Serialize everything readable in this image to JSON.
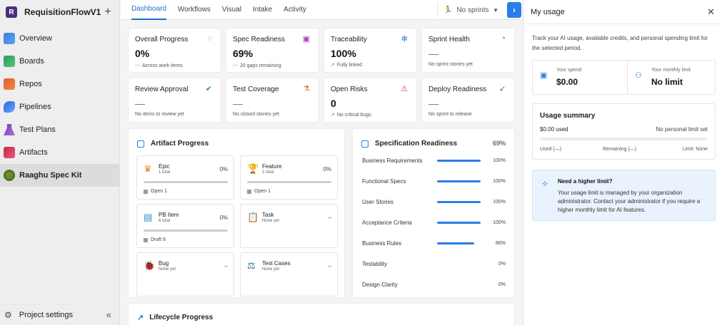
{
  "sidebar": {
    "project_initial": "R",
    "project_name": "RequisitionFlowV1",
    "add_label": "+",
    "items": [
      {
        "label": "Overview",
        "icon": "overview-icon"
      },
      {
        "label": "Boards",
        "icon": "boards-icon"
      },
      {
        "label": "Repos",
        "icon": "repos-icon"
      },
      {
        "label": "Pipelines",
        "icon": "pipelines-icon"
      },
      {
        "label": "Test Plans",
        "icon": "test-plans-icon"
      },
      {
        "label": "Artifacts",
        "icon": "artifacts-icon"
      },
      {
        "label": "Raaghu Spec Kit",
        "icon": "spec-kit-icon",
        "active": true
      }
    ],
    "settings_label": "Project settings",
    "collapse_label": "«"
  },
  "topbar": {
    "tabs": [
      "Dashboard",
      "Workflows",
      "Visual",
      "Intake",
      "Activity"
    ],
    "active_tab": "Dashboard",
    "sprint_label": "No sprints",
    "expand_label": "›"
  },
  "kpis": [
    {
      "title": "Overall Progress",
      "value": "0%",
      "sub": "Across work items",
      "icon": "progress-ring-icon"
    },
    {
      "title": "Spec Readiness",
      "value": "69%",
      "sub": "20 gaps remaining",
      "icon": "spec-icon"
    },
    {
      "title": "Traceability",
      "value": "100%",
      "sub": "Fully linked",
      "icon": "network-icon"
    },
    {
      "title": "Sprint Health",
      "value": "—",
      "sub": "No sprint stories yet",
      "icon": "gauge-icon"
    },
    {
      "title": "Review Approval",
      "value": "—",
      "sub": "No items to review yet",
      "icon": "check-circle-icon"
    },
    {
      "title": "Test Coverage",
      "value": "—",
      "sub": "No closed stories yet",
      "icon": "flask-icon"
    },
    {
      "title": "Open Risks",
      "value": "0",
      "sub": "No critical bugs",
      "icon": "warning-icon"
    },
    {
      "title": "Deploy Readiness",
      "value": "—",
      "sub": "No sprint to release",
      "icon": "rocket-icon"
    }
  ],
  "artifact_progress": {
    "title": "Artifact Progress",
    "items": [
      {
        "name": "Epic",
        "count": "1 total",
        "pct": "0%",
        "status": "Open 1",
        "icon": "crown-icon"
      },
      {
        "name": "Feature",
        "count": "1 total",
        "pct": "0%",
        "status": "Open 1",
        "icon": "trophy-icon"
      },
      {
        "name": "PB Item",
        "count": "6 total",
        "pct": "0%",
        "status": "Draft 6",
        "icon": "document-icon"
      },
      {
        "name": "Task",
        "count": "None yet",
        "pct": "–",
        "status": "",
        "icon": "clipboard-icon"
      },
      {
        "name": "Bug",
        "count": "None yet",
        "pct": "–",
        "status": "",
        "icon": "bug-icon"
      },
      {
        "name": "Test Cases",
        "count": "None yet",
        "pct": "–",
        "status": "",
        "icon": "test-case-icon"
      }
    ]
  },
  "spec_readiness": {
    "title": "Specification Readiness",
    "total": "69%",
    "rows": [
      {
        "label": "Business Requirements",
        "pct": "100%",
        "value": 1.0
      },
      {
        "label": "Functional Specs",
        "pct": "100%",
        "value": 1.0
      },
      {
        "label": "User Stories",
        "pct": "100%",
        "value": 1.0
      },
      {
        "label": "Acceptance Criteria",
        "pct": "100%",
        "value": 1.0
      },
      {
        "label": "Business Rules",
        "pct": "86%",
        "value": 0.86
      },
      {
        "label": "Testability",
        "pct": "0%",
        "value": 0
      },
      {
        "label": "Design Clarity",
        "pct": "0%",
        "value": 0
      }
    ]
  },
  "lifecycle": {
    "title": "Lifecycle Progress"
  },
  "panel": {
    "title": "My usage",
    "close_label": "✕",
    "description": "Track your AI usage, available credits, and personal spending limit for the selected period.",
    "spend_label": "Your spend",
    "spend_value": "$0.00",
    "limit_label": "Your monthly limit",
    "limit_value": "No limit",
    "summary_title": "Usage summary",
    "summary_used": "$0.00 used",
    "summary_limit": "No personal limit set",
    "used_label": "Used (—)",
    "remaining_label": "Remaining (—)",
    "limit_none_label": "Limit: None",
    "notice_title": "Need a higher limit?",
    "notice_body": "Your usage limit is managed by your organization administrator. Contact your administrator if you require a higher monthly limit for AI features."
  },
  "colors": {
    "accent": "#2b7de9",
    "active_tab": "#1b6fd1",
    "warning": "#e07a2b",
    "success": "#2e9c5a"
  }
}
